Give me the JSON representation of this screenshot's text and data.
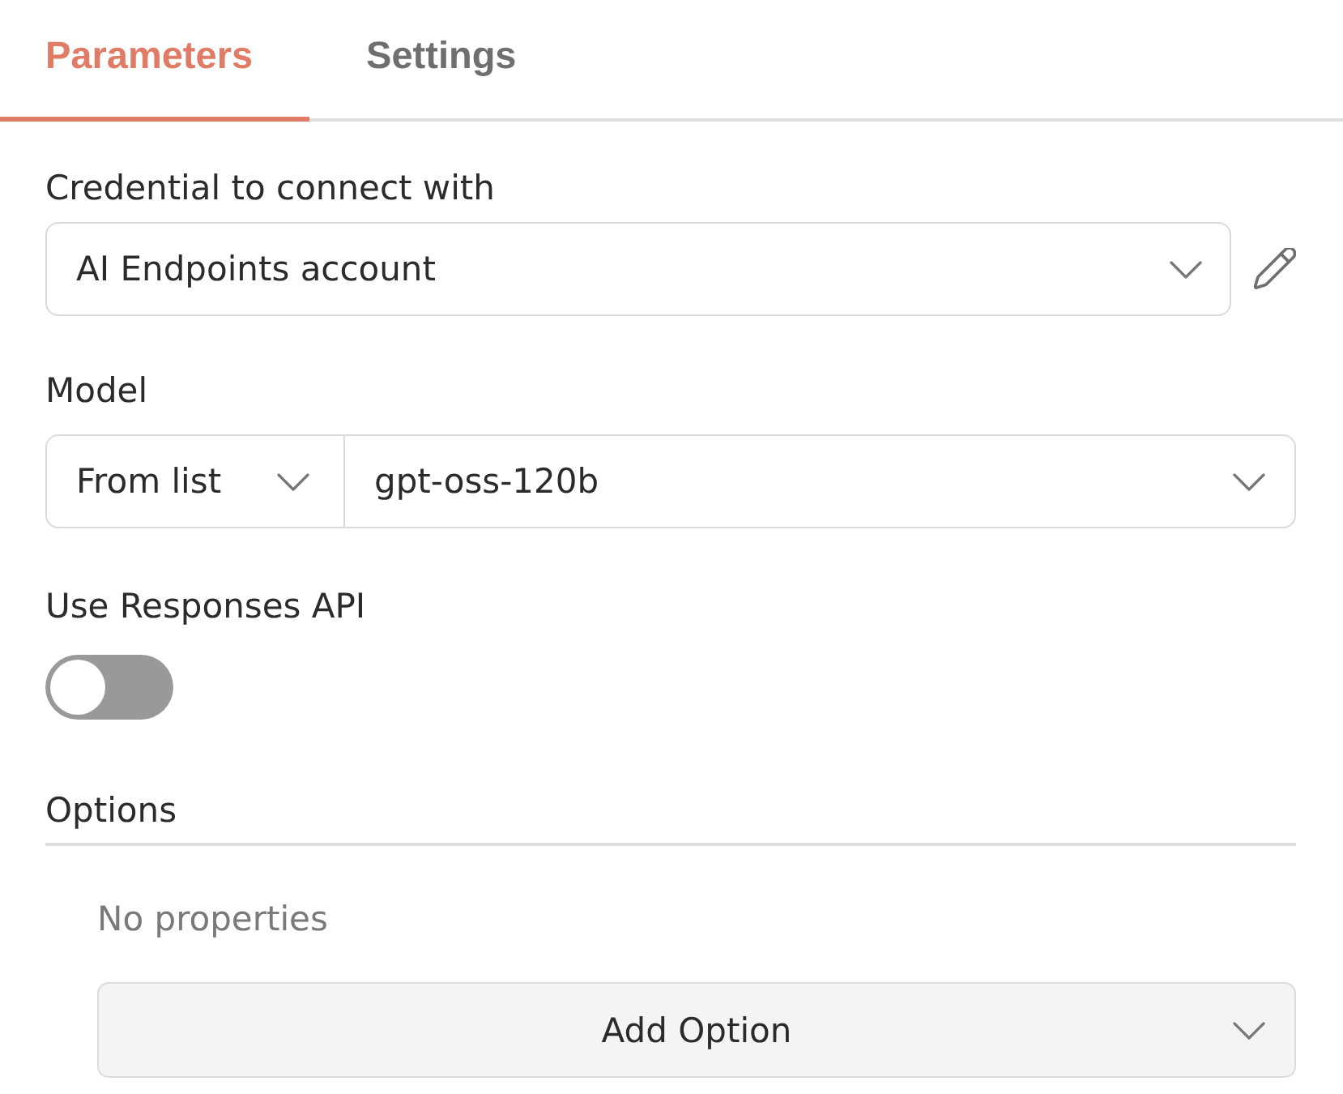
{
  "tabs": [
    {
      "label": "Parameters",
      "selected": true
    },
    {
      "label": "Settings",
      "selected": false
    }
  ],
  "credential": {
    "label": "Credential to connect with",
    "value": "AI Endpoints account"
  },
  "model": {
    "label": "Model",
    "mode": "From list",
    "value": "gpt-oss-120b"
  },
  "responses_api": {
    "label": "Use Responses API",
    "on": false
  },
  "options": {
    "title": "Options",
    "empty_text": "No properties",
    "add_button": "Add Option"
  }
}
